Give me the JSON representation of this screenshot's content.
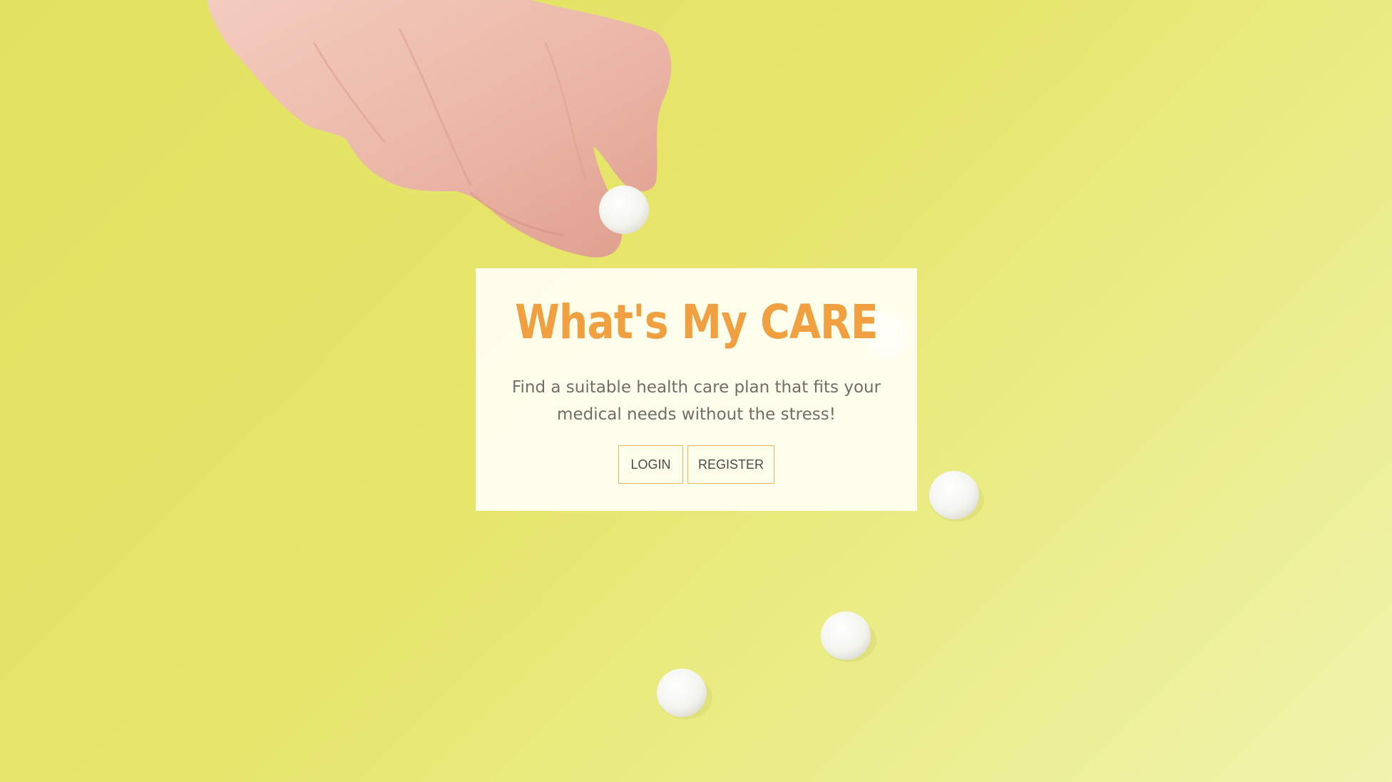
{
  "hero": {
    "title": "What's My CARE",
    "subtitle": "Find a suitable health care plan that fits your medical needs without the stress!",
    "accent_color": "#f0a040"
  },
  "actions": {
    "login_label": "LOGIN",
    "register_label": "REGISTER"
  }
}
